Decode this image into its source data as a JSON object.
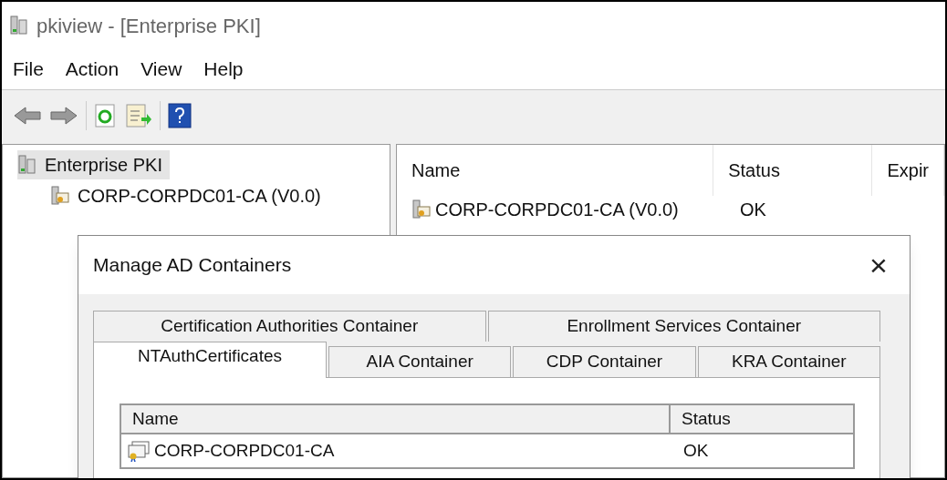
{
  "window": {
    "title": "pkiview - [Enterprise PKI]"
  },
  "menu": [
    "File",
    "Action",
    "View",
    "Help"
  ],
  "tree": [
    {
      "label": "Enterprise PKI",
      "selected": true,
      "children": [
        {
          "label": "CORP-CORPDC01-CA (V0.0)",
          "selected": false
        }
      ]
    }
  ],
  "list": {
    "columns": [
      "Name",
      "Status",
      "Expir"
    ],
    "rows": [
      {
        "name": "CORP-CORPDC01-CA (V0.0)",
        "status": "OK"
      }
    ]
  },
  "dialog": {
    "title": "Manage AD Containers",
    "close": "×",
    "tab_rows": [
      [
        {
          "label": "Certification Authorities Container",
          "selected": false
        },
        {
          "label": "Enrollment Services Container",
          "selected": false
        }
      ],
      [
        {
          "label": "NTAuthCertificates",
          "selected": true
        },
        {
          "label": "AIA Container",
          "selected": false
        },
        {
          "label": "CDP Container",
          "selected": false
        },
        {
          "label": "KRA Container",
          "selected": false
        }
      ]
    ],
    "table": {
      "columns": [
        "Name",
        "Status"
      ],
      "rows": [
        {
          "name": "CORP-CORPDC01-CA",
          "status": "OK"
        }
      ]
    }
  }
}
